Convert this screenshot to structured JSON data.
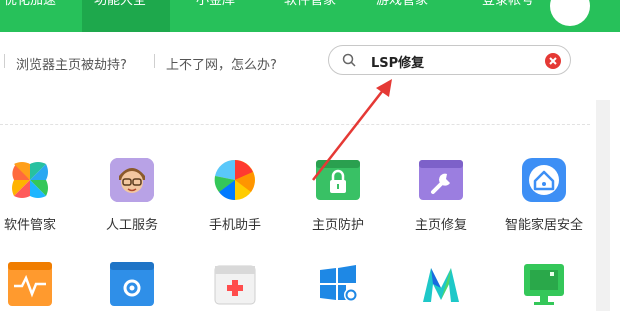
{
  "topnav": {
    "items": [
      {
        "label": "优化加速"
      },
      {
        "label": "功能大全"
      },
      {
        "label": "小金库"
      },
      {
        "label": "软件管家"
      },
      {
        "label": "游戏管家"
      },
      {
        "label": "登录帐号"
      }
    ],
    "active_index": 1
  },
  "links": [
    {
      "label": "浏览器主页被劫持?"
    },
    {
      "label": "上不了网，怎么办?"
    }
  ],
  "search": {
    "value": "LSP修复",
    "icon": "search-icon",
    "clear_icon": "clear-icon"
  },
  "tools_row1": [
    {
      "label": "软件管家",
      "icon": "software-manager-icon"
    },
    {
      "label": "人工服务",
      "icon": "human-service-icon"
    },
    {
      "label": "手机助手",
      "icon": "phone-assistant-icon"
    },
    {
      "label": "主页防护",
      "icon": "homepage-lock-icon"
    },
    {
      "label": "主页修复",
      "icon": "homepage-repair-icon"
    },
    {
      "label": "智能家居安全",
      "icon": "smart-home-icon"
    }
  ],
  "tools_row2": [
    {
      "icon": "monitor-pulse-icon"
    },
    {
      "icon": "window-gear-icon"
    },
    {
      "icon": "first-aid-kit-icon"
    },
    {
      "icon": "windows-gear-icon"
    },
    {
      "icon": "m-logo-icon"
    },
    {
      "icon": "green-monitor-icon"
    }
  ],
  "colors": {
    "brand_green": "#27c15a",
    "arrow_red": "#e53935"
  }
}
